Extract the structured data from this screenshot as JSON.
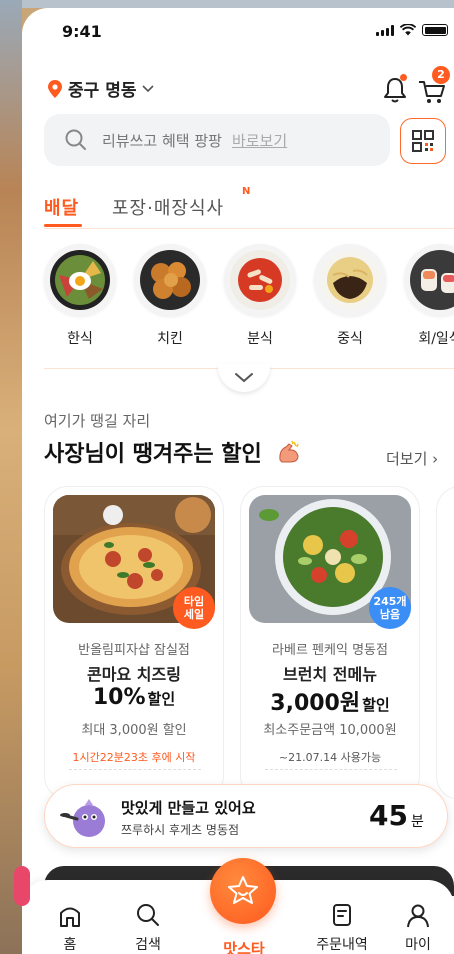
{
  "status": {
    "time": "9:41"
  },
  "header": {
    "location": "중구 명동",
    "cart_count": "2"
  },
  "search": {
    "placeholder": "리뷰쓰고 혜택 팡팡",
    "link": "바로보기"
  },
  "tabs": [
    {
      "label": "배달",
      "active": true
    },
    {
      "label": "포장·매장식사",
      "badge": "N"
    }
  ],
  "categories": [
    {
      "label": "한식",
      "icon": "bibimbap-icon"
    },
    {
      "label": "치킨",
      "icon": "fried-chicken-icon"
    },
    {
      "label": "분식",
      "icon": "tteokbokki-icon"
    },
    {
      "label": "중식",
      "icon": "jajangmyeon-icon"
    },
    {
      "label": "회/일식",
      "icon": "sushi-icon"
    }
  ],
  "section": {
    "subtitle": "여기가 땡길 자리",
    "title": "사장님이 땡겨주는 할인",
    "more": "더보기"
  },
  "deals": [
    {
      "badge": "타임\n세일",
      "store": "반올림피자샵 잠실점",
      "name": "콘마요 치즈링",
      "value": "10%",
      "suffix": "할인",
      "condition": "최대 3,000원 할인",
      "note": "1시간22분23초 후에 시작"
    },
    {
      "badge": "245개\n남음",
      "store": "라베르 펜케익 명동점",
      "name": "브런치 전메뉴",
      "value": "3,000원",
      "suffix": "할인",
      "condition": "최소주문금액 10,000원",
      "note": "~21.07.14 사용가능"
    }
  ],
  "order": {
    "title": "맛있게 만들고 있어요",
    "store": "쯔루하시 후게츠 명동점",
    "minutes": "45",
    "unit": "분"
  },
  "nav": [
    {
      "label": "홈",
      "icon": "home-icon"
    },
    {
      "label": "검색",
      "icon": "search-icon"
    },
    {
      "label": "맛스타",
      "icon": "star-icon",
      "active": true
    },
    {
      "label": "주문내역",
      "icon": "receipt-icon"
    },
    {
      "label": "마이",
      "icon": "person-icon"
    }
  ],
  "colors": {
    "accent": "#ff5a1f",
    "timeSaleBadge": "#ff5a1f",
    "stockBadge": "#3a8ef6"
  }
}
